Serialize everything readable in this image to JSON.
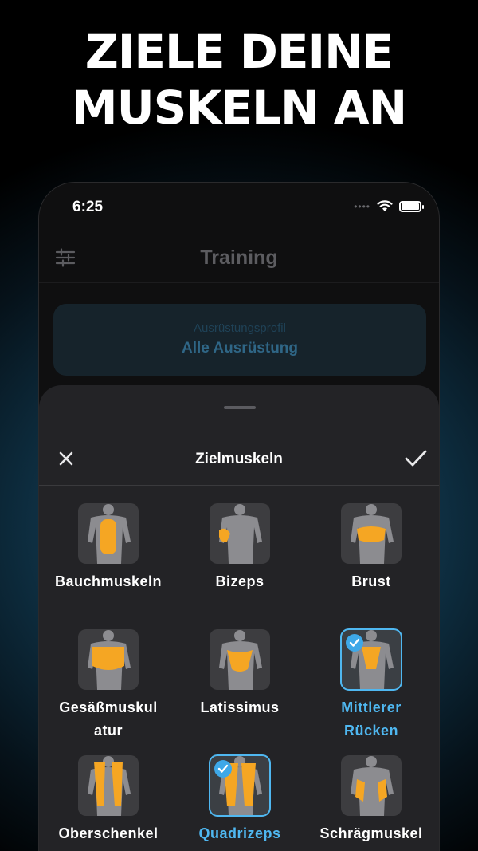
{
  "headline": {
    "line1": "ZIELE DEINE",
    "line2": "MUSKELN AN"
  },
  "status_bar": {
    "time": "6:25",
    "dots": "••••"
  },
  "nav": {
    "title": "Training"
  },
  "equipment": {
    "label": "Ausrüstungsprofil",
    "value": "Alle Ausrüstung"
  },
  "sheet": {
    "title": "Zielmuskeln"
  },
  "muscles": [
    {
      "label": "Bauchmuskeln",
      "label2": "",
      "selected": false
    },
    {
      "label": "Bizeps",
      "label2": "",
      "selected": false
    },
    {
      "label": "Brust",
      "label2": "",
      "selected": false
    },
    {
      "label": "Gesäßmuskul",
      "label2": "atur",
      "selected": false
    },
    {
      "label": "Latissimus",
      "label2": "",
      "selected": false
    },
    {
      "label": "Mittlerer",
      "label2": "Rücken",
      "selected": true
    },
    {
      "label": "Oberschenkel",
      "label2": "",
      "selected": false
    },
    {
      "label": "Quadrizeps",
      "label2": "",
      "selected": true
    },
    {
      "label": "Schrägmuskel",
      "label2": "",
      "selected": false
    }
  ],
  "colors": {
    "accent": "#4fb7f0",
    "highlight": "#f5a623",
    "sheet_bg": "#232326",
    "thumb_bg": "#3d3d40"
  }
}
